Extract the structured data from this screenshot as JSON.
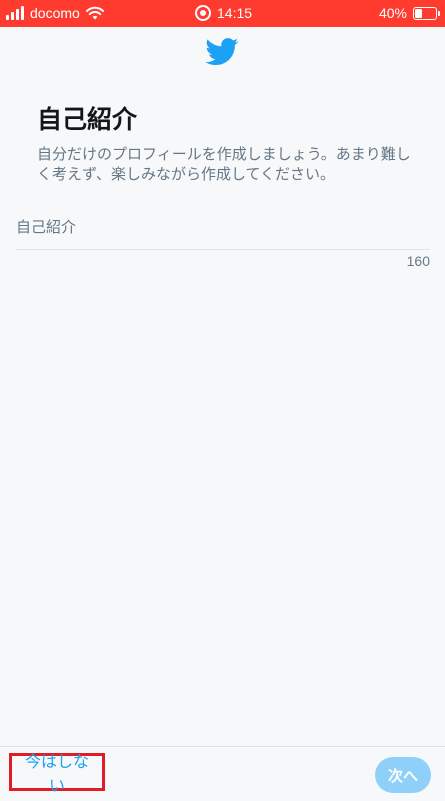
{
  "status_bar": {
    "carrier": "docomo",
    "time": "14:15",
    "battery": "40%"
  },
  "brand": {
    "accent_color": "#1DA1F2",
    "logo_icon": "twitter-bird-icon"
  },
  "page": {
    "title": "自己紹介",
    "description": "自分だけのプロフィールを作成しましょう。あまり難しく考えず、楽しみながら作成してください。"
  },
  "bio_field": {
    "placeholder": "自己紹介",
    "value": "",
    "char_counter": "160"
  },
  "footer": {
    "skip_label": "今はしない",
    "next_label": "次へ",
    "next_button_color": "#8ED0F9"
  }
}
